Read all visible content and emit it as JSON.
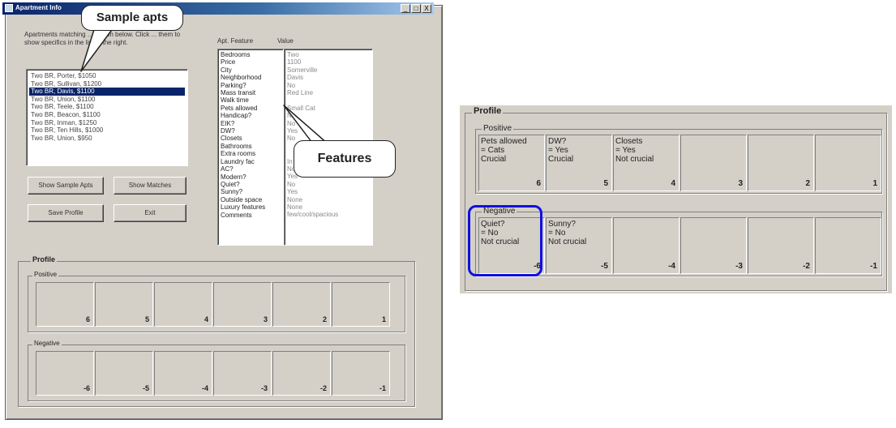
{
  "window": {
    "title": "Apartment Info",
    "minimize": "_",
    "maximize": "□",
    "close": "X"
  },
  "intro_text": "Apartments matching ... shown below. Click ... them to show specifics in the list to the right.",
  "apartments": [
    {
      "label": "Two BR, Porter, $1050",
      "selected": false
    },
    {
      "label": "Two BR, Sullivan, $1200",
      "selected": false
    },
    {
      "label": "Two BR, Davis, $1100",
      "selected": true
    },
    {
      "label": "Two BR, Union, $1100",
      "selected": false
    },
    {
      "label": "Two BR, Teele, $1100",
      "selected": false
    },
    {
      "label": "Two BR, Beacon, $1100",
      "selected": false
    },
    {
      "label": "Two BR, Inman, $1250",
      "selected": false
    },
    {
      "label": "Two BR, Ten Hills, $1000",
      "selected": false
    },
    {
      "label": "Two BR, Union, $950",
      "selected": false
    }
  ],
  "buttons": {
    "show_samples": "Show Sample Apts",
    "show_matches": "Show Matches",
    "save_profile": "Save Profile",
    "exit": "Exit"
  },
  "columns": {
    "feature": "Apt. Feature",
    "value": "Value"
  },
  "features": [
    {
      "name": "Bedrooms",
      "value": "Two"
    },
    {
      "name": "Price",
      "value": "1100"
    },
    {
      "name": "City",
      "value": "Somerville"
    },
    {
      "name": "Neighborhood",
      "value": "Davis"
    },
    {
      "name": "Parking?",
      "value": "No"
    },
    {
      "name": "Mass transit",
      "value": "Red Line"
    },
    {
      "name": "Walk time",
      "value": ""
    },
    {
      "name": "Pets allowed",
      "value": "Small Cat"
    },
    {
      "name": "Handicap?",
      "value": "No"
    },
    {
      "name": "EIK?",
      "value": "No"
    },
    {
      "name": "DW?",
      "value": "Yes"
    },
    {
      "name": "Closets",
      "value": "No"
    },
    {
      "name": "Bathrooms",
      "value": ""
    },
    {
      "name": "Extra rooms",
      "value": ""
    },
    {
      "name": "Laundry fac",
      "value": "In Bldg"
    },
    {
      "name": "AC?",
      "value": "No"
    },
    {
      "name": "Modern?",
      "value": "Yes"
    },
    {
      "name": "Quiet?",
      "value": "No"
    },
    {
      "name": "Sunny?",
      "value": "Yes"
    },
    {
      "name": "Outside space",
      "value": "None"
    },
    {
      "name": "Luxury features",
      "value": "None"
    },
    {
      "name": "Comments",
      "value": "few/cool/spacious"
    }
  ],
  "callouts": {
    "sample": "Sample apts",
    "features": "Features"
  },
  "left_profile": {
    "title": "Profile",
    "positive_label": "Positive",
    "negative_label": "Negative",
    "positive_nums": [
      "6",
      "5",
      "4",
      "3",
      "2",
      "1"
    ],
    "negative_nums": [
      "-6",
      "-5",
      "-4",
      "-3",
      "-2",
      "-1"
    ]
  },
  "right_profile": {
    "title": "Profile",
    "positive_label": "Positive",
    "negative_label": "Negative",
    "positive": [
      {
        "lines": [
          "Pets allowed",
          "= Cats",
          "Crucial"
        ],
        "num": "6"
      },
      {
        "lines": [
          "DW?",
          "= Yes",
          "Crucial"
        ],
        "num": "5"
      },
      {
        "lines": [
          "Closets",
          "= Yes",
          "Not crucial"
        ],
        "num": "4"
      },
      {
        "lines": [],
        "num": "3"
      },
      {
        "lines": [],
        "num": "2"
      },
      {
        "lines": [],
        "num": "1"
      }
    ],
    "negative": [
      {
        "lines": [
          "Quiet?",
          "= No",
          "Not crucial"
        ],
        "num": "-6"
      },
      {
        "lines": [
          "Sunny?",
          "= No",
          "Not crucial"
        ],
        "num": "-5"
      },
      {
        "lines": [],
        "num": "-4"
      },
      {
        "lines": [],
        "num": "-3"
      },
      {
        "lines": [],
        "num": "-2"
      },
      {
        "lines": [],
        "num": "-1"
      }
    ]
  },
  "colors": {
    "highlight": "#1010e0",
    "selection": "#0a246a",
    "face": "#d4d0c8"
  }
}
